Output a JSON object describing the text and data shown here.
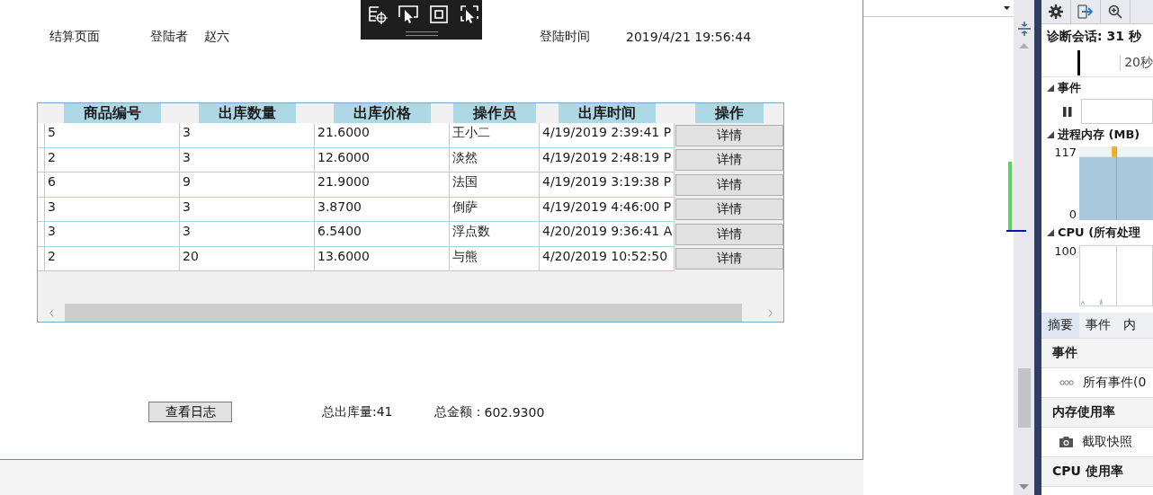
{
  "app_window": {
    "page_title": "结算页面",
    "user_label": "登陆者",
    "user_name": "赵六",
    "login_time_label": "登陆时间",
    "login_time": "2019/4/21 19:56:44",
    "table": {
      "columns": [
        "商品编号",
        "出库数量",
        "出库价格",
        "操作员",
        "出库时间",
        "操作"
      ],
      "rows": [
        {
          "cells": [
            "5",
            "3",
            "21.6000",
            "王小二",
            "4/19/2019 2:39:41 P"
          ],
          "action": "详情"
        },
        {
          "cells": [
            "2",
            "3",
            "12.6000",
            "淡然",
            "4/19/2019 2:48:19 P"
          ],
          "action": "详情"
        },
        {
          "cells": [
            "6",
            "9",
            "21.9000",
            "法国",
            "4/19/2019 3:19:38 P"
          ],
          "action": "详情"
        },
        {
          "cells": [
            "3",
            "3",
            "3.8700",
            "倒萨",
            "4/19/2019 4:46:00 P"
          ],
          "action": "详情"
        },
        {
          "cells": [
            "3",
            "3",
            "6.5400",
            "浮点数",
            "4/20/2019 9:36:41 A"
          ],
          "action": "详情"
        },
        {
          "cells": [
            "2",
            "20",
            "13.6000",
            "与熊",
            "4/20/2019 10:52:50"
          ],
          "action": "详情"
        }
      ]
    },
    "log_button": "查看日志",
    "total_quantity": "总出库量:41",
    "total_amount_label": "总金额：",
    "total_amount": "602.9300"
  },
  "diagnostics": {
    "session": "诊断会话: 31 秒",
    "timeline_tick": "20秒",
    "events_title": "事件",
    "memory_title": "进程内存 (MB)",
    "memory_max": "117",
    "memory_min": "0",
    "cpu_title": "CPU (所有处理",
    "cpu_max": "100",
    "tabs": [
      {
        "label": "摘要",
        "selected": true
      },
      {
        "label": "事件",
        "selected": false
      },
      {
        "label": "内",
        "selected": false
      }
    ],
    "sections": [
      {
        "kind": "header",
        "label": "事件"
      },
      {
        "kind": "events",
        "label": "所有事件(0"
      },
      {
        "kind": "header",
        "label": "内存使用率"
      },
      {
        "kind": "snapshot",
        "label": "截取快照"
      },
      {
        "kind": "header",
        "label": "CPU 使用率"
      }
    ]
  }
}
